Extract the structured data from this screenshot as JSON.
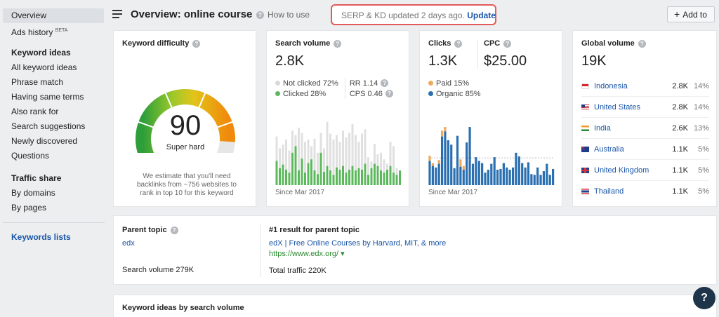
{
  "sidebar": {
    "items_top": [
      {
        "label": "Overview",
        "active": true
      },
      {
        "label": "Ads history",
        "sup": "BETA"
      }
    ],
    "keyword_ideas_heading": "Keyword ideas",
    "keyword_ideas": [
      {
        "label": "All keyword ideas"
      },
      {
        "label": "Phrase match"
      },
      {
        "label": "Having same terms"
      },
      {
        "label": "Also rank for"
      },
      {
        "label": "Search suggestions"
      },
      {
        "label": "Newly discovered"
      },
      {
        "label": "Questions"
      }
    ],
    "traffic_share_heading": "Traffic share",
    "traffic_share": [
      {
        "label": "By domains"
      },
      {
        "label": "By pages"
      }
    ],
    "keywords_lists_heading": "Keywords lists"
  },
  "header": {
    "title": "Overview: online course",
    "how_to_use": "How to use",
    "notice_text": "SERP & KD updated 2 days ago.",
    "notice_link": "Update",
    "add_to": "Add to"
  },
  "kd": {
    "title": "Keyword difficulty",
    "value": "90",
    "label": "Super hard",
    "description": "We estimate that you'll need backlinks from ~756 websites to rank in top 10 for this keyword",
    "gauge_fraction": 0.9
  },
  "search_volume": {
    "title": "Search volume",
    "value": "2.8K",
    "not_clicked": "Not clicked 72%",
    "clicked": "Clicked 28%",
    "rr": "RR 1.14",
    "cps": "CPS 0.46",
    "since": "Since Mar 2017",
    "colors": {
      "clicked": "#5cb85c",
      "not_clicked": "#e0e0e0"
    },
    "bars_total": [
      0.66,
      0.5,
      0.55,
      0.62,
      0.47,
      0.74,
      0.68,
      0.78,
      0.71,
      0.59,
      0.62,
      0.53,
      0.63,
      0.44,
      0.71,
      0.5,
      0.86,
      0.7,
      0.62,
      0.68,
      0.59,
      0.74,
      0.65,
      0.71,
      0.83,
      0.68,
      0.59,
      0.7,
      0.76,
      0.38,
      0.32,
      0.56,
      0.42,
      0.44,
      0.35,
      0.29,
      0.59,
      0.53,
      0.23,
      0.2
    ],
    "bars_clicked": [
      0.33,
      0.23,
      0.28,
      0.21,
      0.17,
      0.44,
      0.53,
      0.2,
      0.36,
      0.17,
      0.3,
      0.35,
      0.2,
      0.15,
      0.44,
      0.18,
      0.26,
      0.2,
      0.14,
      0.24,
      0.21,
      0.26,
      0.17,
      0.21,
      0.26,
      0.2,
      0.23,
      0.21,
      0.29,
      0.14,
      0.23,
      0.29,
      0.26,
      0.2,
      0.17,
      0.21,
      0.26,
      0.17,
      0.14,
      0.2
    ]
  },
  "clicks": {
    "title": "Clicks",
    "value": "1.3K",
    "cpc_title": "CPC",
    "cpc_value": "$25.00",
    "paid": "Paid 15%",
    "organic": "Organic 85%",
    "since": "Since Mar 2017",
    "colors": {
      "paid": "#f0a95b",
      "organic": "#2a6fb0"
    },
    "bars_organic": [
      0.33,
      0.26,
      0.24,
      0.29,
      0.66,
      0.73,
      0.61,
      0.55,
      0.23,
      0.67,
      0.25,
      0.21,
      0.58,
      0.79,
      0.29,
      0.38,
      0.33,
      0.3,
      0.17,
      0.21,
      0.29,
      0.38,
      0.21,
      0.22,
      0.3,
      0.24,
      0.21,
      0.24,
      0.44,
      0.39,
      0.3,
      0.24,
      0.31,
      0.15,
      0.14,
      0.24,
      0.14,
      0.19,
      0.29,
      0.14,
      0.22
    ],
    "bars_paid": [
      0.07,
      0.04,
      0.0,
      0.05,
      0.08,
      0.06,
      0.0,
      0.0,
      0.0,
      0.0,
      0.1,
      0.05,
      0.0,
      0.0,
      0.0,
      0.0,
      0.0,
      0.0,
      0.0,
      0.0,
      0.0,
      0.0,
      0.0,
      0.0,
      0.0,
      0.0,
      0.0,
      0.0,
      0.0,
      0.0,
      0.0,
      0.0,
      0.0,
      0.0,
      0.0,
      0.0,
      0.0,
      0.0,
      0.0,
      0.0,
      0.0
    ]
  },
  "global_volume": {
    "title": "Global volume",
    "value": "19K",
    "countries": [
      {
        "name": "Indonesia",
        "volume": "2.8K",
        "pct": "14%",
        "flag": "indonesia"
      },
      {
        "name": "United States",
        "volume": "2.8K",
        "pct": "14%",
        "flag": "united-states"
      },
      {
        "name": "India",
        "volume": "2.6K",
        "pct": "13%",
        "flag": "india"
      },
      {
        "name": "Australia",
        "volume": "1.1K",
        "pct": "5%",
        "flag": "australia"
      },
      {
        "name": "United Kingdom",
        "volume": "1.1K",
        "pct": "5%",
        "flag": "united-kingdom"
      },
      {
        "name": "Thailand",
        "volume": "1.1K",
        "pct": "5%",
        "flag": "thailand"
      }
    ]
  },
  "parent_topic": {
    "title": "Parent topic",
    "topic": "edx",
    "search_volume": "Search volume 279K",
    "result_title": "#1 result for parent topic",
    "result_link": "edX | Free Online Courses by Harvard, MIT, & more",
    "result_url": "https://www.edx.org/",
    "total_traffic": "Total traffic 220K"
  },
  "keyword_ideas_card": {
    "title": "Keyword ideas by search volume"
  },
  "help_button": "?"
}
